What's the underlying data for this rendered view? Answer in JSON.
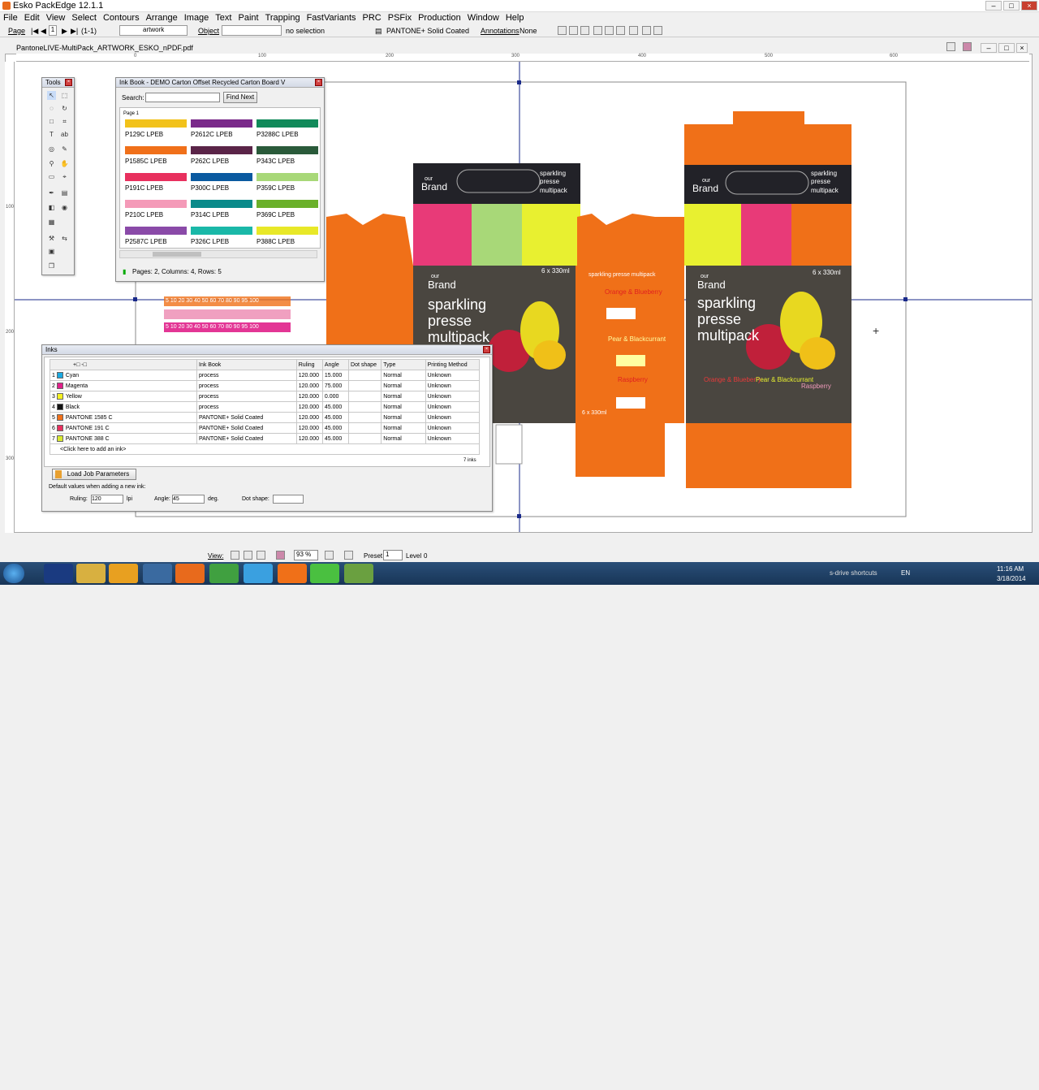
{
  "app": {
    "title": "Esko PackEdge 12.1.1"
  },
  "menu": [
    "File",
    "Edit",
    "View",
    "Select",
    "Contours",
    "Arrange",
    "Image",
    "Text",
    "Paint",
    "Trapping",
    "FastVariants",
    "PRC",
    "PSFix",
    "Production",
    "Window",
    "Help"
  ],
  "toolbar": {
    "page_label": "Page",
    "page_num": "1",
    "page_range": "(1-1)",
    "layer_value": "artwork",
    "object_label": "Object",
    "selection_text": "no selection",
    "ink_book_value": "PANTONE+ Solid Coated",
    "annotations_label": "Annotations",
    "annotations_value": "None"
  },
  "document": {
    "tab": "PantoneLIVE-MultiPack_ARTWORK_ESKO_nPDF.pdf"
  },
  "ruler_h": [
    "0",
    "100",
    "200",
    "300",
    "400",
    "500",
    "600"
  ],
  "ruler_v": [
    "100",
    "200",
    "300"
  ],
  "tools_panel": {
    "title": "Tools"
  },
  "ink_book": {
    "title": "Ink Book - DEMO Carton Offset Recycled Carton Board V",
    "search_label": "Search:",
    "search_value": "",
    "find_next": "Find Next",
    "page_label": "Page 1",
    "swatches": [
      {
        "name": "P129C LPEB",
        "color": "#f2c21b"
      },
      {
        "name": "P2612C LPEB",
        "color": "#7a2a8a"
      },
      {
        "name": "P3288C LPEB",
        "color": "#118a5a"
      },
      {
        "name": "P1585C LPEB",
        "color": "#f0701a"
      },
      {
        "name": "P262C LPEB",
        "color": "#5a2448"
      },
      {
        "name": "P343C LPEB",
        "color": "#2a5a3a"
      },
      {
        "name": "P191C LPEB",
        "color": "#e8305e"
      },
      {
        "name": "P300C LPEB",
        "color": "#0a5aa0"
      },
      {
        "name": "P359C LPEB",
        "color": "#a8d878"
      },
      {
        "name": "P210C LPEB",
        "color": "#f49ab8"
      },
      {
        "name": "P314C LPEB",
        "color": "#0a8a8a"
      },
      {
        "name": "P369C LPEB",
        "color": "#6ab02a"
      },
      {
        "name": "P2587C LPEB",
        "color": "#8a4aa8"
      },
      {
        "name": "P326C LPEB",
        "color": "#1ab8a8"
      },
      {
        "name": "P388C LPEB",
        "color": "#e8e828"
      }
    ],
    "status": "Pages: 2, Columns: 4, Rows: 5"
  },
  "inks_panel": {
    "title": "Inks",
    "headers": [
      "",
      "Ink Book",
      "Ruling",
      "Angle",
      "Dot shape",
      "Type",
      "Printing Method"
    ],
    "rows": [
      {
        "n": "1",
        "name": "Cyan",
        "color": "#1aa8e0",
        "book": "process",
        "ruling": "120.000",
        "angle": "15.000",
        "dot": "",
        "type": "Normal",
        "method": "Unknown"
      },
      {
        "n": "2",
        "name": "Magenta",
        "color": "#e0208a",
        "book": "process",
        "ruling": "120.000",
        "angle": "75.000",
        "dot": "",
        "type": "Normal",
        "method": "Unknown"
      },
      {
        "n": "3",
        "name": "Yellow",
        "color": "#f4f020",
        "book": "process",
        "ruling": "120.000",
        "angle": "0.000",
        "dot": "",
        "type": "Normal",
        "method": "Unknown"
      },
      {
        "n": "4",
        "name": "Black",
        "color": "#111111",
        "book": "process",
        "ruling": "120.000",
        "angle": "45.000",
        "dot": "",
        "type": "Normal",
        "method": "Unknown"
      },
      {
        "n": "5",
        "name": "PANTONE 1585 C",
        "color": "#f0701a",
        "book": "PANTONE+ Solid Coated",
        "ruling": "120.000",
        "angle": "45.000",
        "dot": "",
        "type": "Normal",
        "method": "Unknown"
      },
      {
        "n": "6",
        "name": "PANTONE 191 C",
        "color": "#e8305e",
        "book": "PANTONE+ Solid Coated",
        "ruling": "120.000",
        "angle": "45.000",
        "dot": "",
        "type": "Normal",
        "method": "Unknown"
      },
      {
        "n": "7",
        "name": "PANTONE 388 C",
        "color": "#d8e830",
        "book": "PANTONE+ Solid Coated",
        "ruling": "120.000",
        "angle": "45.000",
        "dot": "",
        "type": "Normal",
        "method": "Unknown"
      }
    ],
    "add_ink": "<Click here to add an ink>",
    "count": "7 inks",
    "load_button": "Load Job Parameters",
    "defaults_label": "Default values when adding a new ink:",
    "ruling_label": "Ruling:",
    "ruling_value": "120",
    "ruling_unit": "lpi",
    "angle_label": "Angle:",
    "angle_value": "45",
    "angle_unit": "deg.",
    "dot_label": "Dot shape:",
    "dot_value": ""
  },
  "artwork": {
    "brand_small": "our",
    "brand": "Brand",
    "line1": "sparkling",
    "line2": "presse",
    "line3": "multipack",
    "count": "6 x 330ml",
    "flavor1": "Orange & Blueberry",
    "flavor2": "Pear & Blackcurrant",
    "flavor3": "Raspberry",
    "side_text": "sparkling presse multipack",
    "tint_row1": "5 10 20 30 40 50 60 70 80 90 95 100",
    "tint_row2": "5 10 20 30 40 50 60 70 80 90 95 100"
  },
  "status": {
    "view_label": "View:",
    "zoom": "93 %",
    "preset_label": "Preset",
    "preset_value": "1",
    "level_label": "Level",
    "level_value": "0"
  },
  "taskbar": {
    "shortcut": "s-drive shortcuts",
    "lang": "EN",
    "time": "11:16 AM",
    "date": "3/18/2014"
  }
}
